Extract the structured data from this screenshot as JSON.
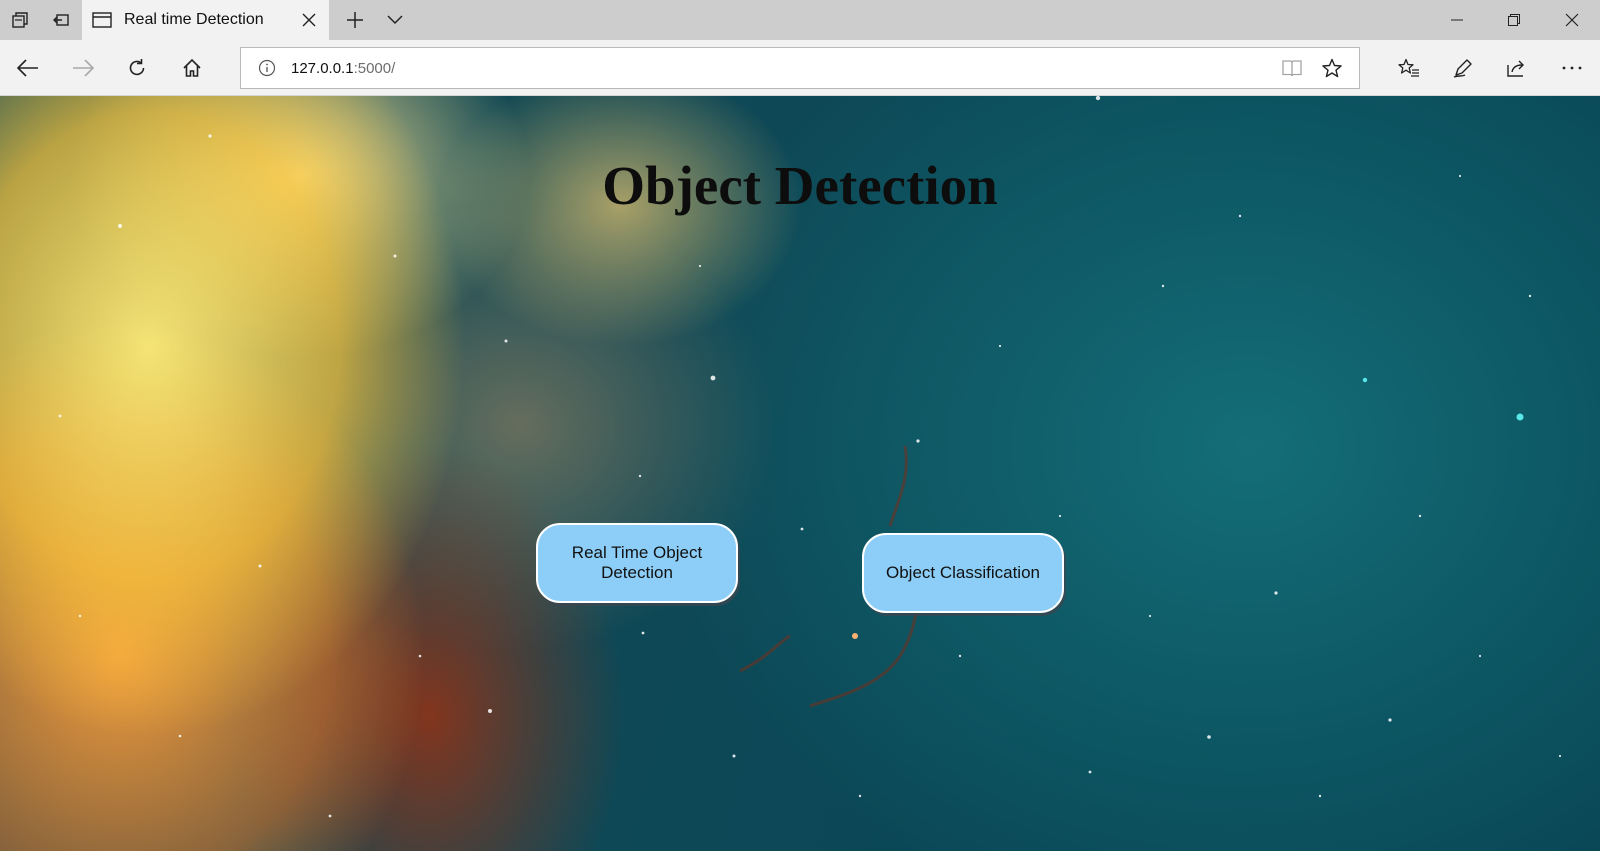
{
  "browser": {
    "tab": {
      "title": "Real time Detection"
    },
    "address_bar": {
      "url_host": "127.0.0.1",
      "url_rest": ":5000/"
    },
    "icons": {
      "tab_actions": "tab-actions-icon",
      "set_aside_tabs": "set-aside-tabs-icon",
      "page": "page-icon",
      "close_tab": "close-icon",
      "new_tab": "plus-icon",
      "tab_list": "chevron-down-icon",
      "minimize": "minimize-icon",
      "restore": "restore-icon",
      "close_window": "close-window-icon",
      "back": "back-arrow-icon",
      "forward": "forward-arrow-icon",
      "refresh": "refresh-icon",
      "home": "home-icon",
      "site_info": "info-icon",
      "reading_view": "reading-view-icon",
      "favorite": "star-icon",
      "favorites_hub": "favorites-hub-icon",
      "web_note": "pen-icon",
      "share": "share-icon",
      "more": "more-icon"
    }
  },
  "page": {
    "title": "Object Detection",
    "buttons": {
      "realtime": "Real Time Object Detection",
      "classification": "Object Classification"
    },
    "colors": {
      "button_fill": "#8ccef7",
      "button_border": "#ffffff",
      "title_color": "#0d0d0d"
    }
  }
}
